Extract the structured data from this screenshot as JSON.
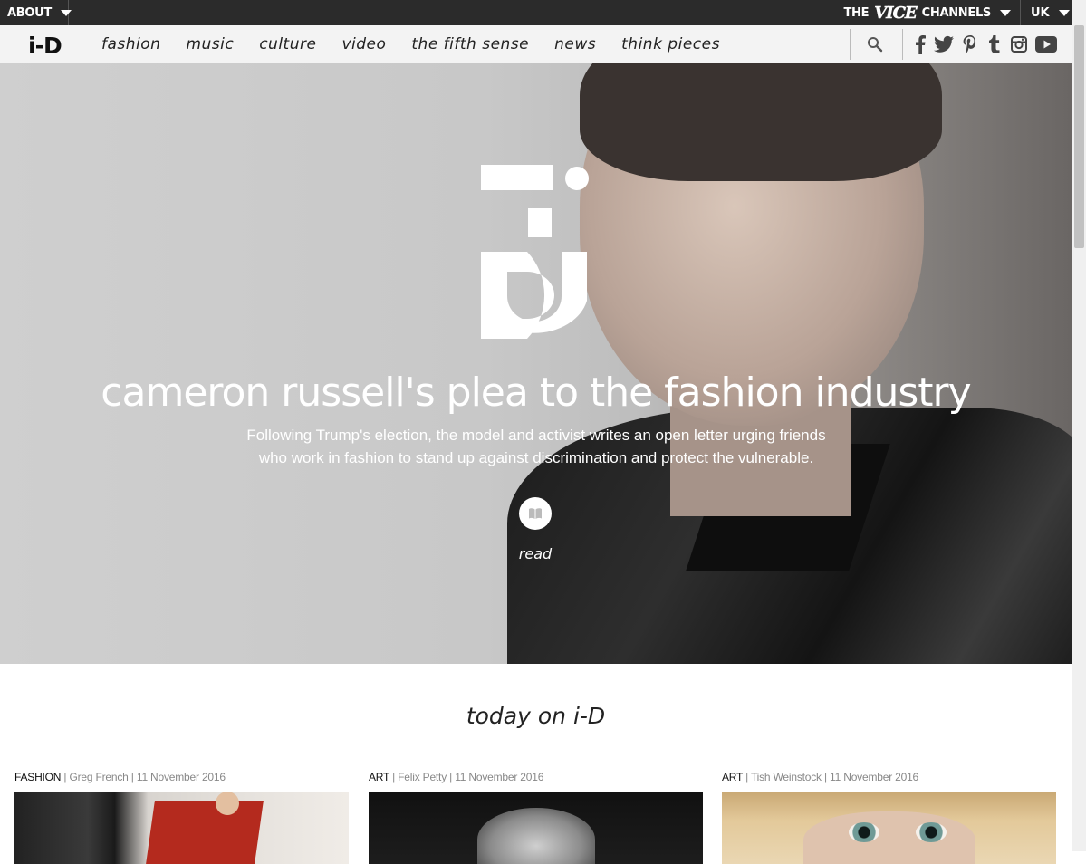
{
  "topbar": {
    "about_label": "ABOUT",
    "vice_prefix": "THE",
    "vice_logo": "VICE",
    "vice_suffix": "CHANNELS",
    "region_label": "UK"
  },
  "nav": {
    "logo": "i-D",
    "links": [
      "fashion",
      "music",
      "culture",
      "video",
      "the fifth sense",
      "news",
      "think pieces"
    ],
    "search_icon": "search-icon",
    "socials": [
      "facebook-icon",
      "twitter-icon",
      "pinterest-icon",
      "tumblr-icon",
      "instagram-icon",
      "youtube-icon"
    ]
  },
  "hero": {
    "title": "cameron russell's plea to the fashion industry",
    "subtitle": "Following Trump's election, the model and activist writes an open letter urging friends who work in fashion to stand up against discrimination and protect the vulnerable.",
    "read_label": "read"
  },
  "today": {
    "heading": "today on i-D",
    "cards": [
      {
        "category": "FASHION",
        "author": "Greg French",
        "date": "11 November 2016"
      },
      {
        "category": "ART",
        "author": "Felix Petty",
        "date": "11 November 2016"
      },
      {
        "category": "ART",
        "author": "Tish Weinstock",
        "date": "11 November 2016"
      }
    ]
  },
  "colors": {
    "topbar_bg": "#2b2b2b",
    "nav_bg": "#f3f3f3",
    "text_dark": "#222222"
  }
}
